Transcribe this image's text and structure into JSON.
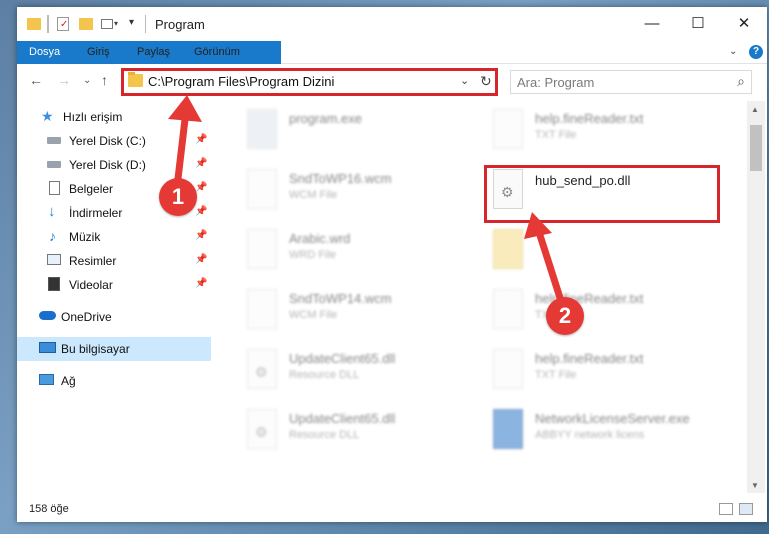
{
  "window": {
    "title": "Program",
    "minimize_icon": "minimize-icon",
    "maximize_icon": "maximize-icon",
    "close_icon": "close-icon",
    "help_icon": "help-icon"
  },
  "ribbon": {
    "tabs": [
      "Dosya",
      "Giriş",
      "Paylaş",
      "Görünüm"
    ]
  },
  "address": {
    "path": "C:\\Program Files\\Program Dizini",
    "search_placeholder": "Ara: Program"
  },
  "nav": {
    "items": [
      {
        "label": "Hızlı erişim",
        "icon": "star-icon",
        "pinned": false
      },
      {
        "label": "Yerel Disk (C:)",
        "icon": "drive-icon",
        "pinned": true
      },
      {
        "label": "Yerel Disk (D:)",
        "icon": "drive-icon",
        "pinned": true
      },
      {
        "label": "Belgeler",
        "icon": "documents-icon",
        "pinned": true
      },
      {
        "label": "İndirmeler",
        "icon": "download-icon",
        "pinned": true
      },
      {
        "label": "Müzik",
        "icon": "music-icon",
        "pinned": true
      },
      {
        "label": "Resimler",
        "icon": "pictures-icon",
        "pinned": true
      },
      {
        "label": "Videolar",
        "icon": "video-icon",
        "pinned": true
      },
      {
        "label": "OneDrive",
        "icon": "cloud-icon",
        "pinned": false
      },
      {
        "label": "Bu bilgisayar",
        "icon": "computer-icon",
        "pinned": false
      },
      {
        "label": "Ağ",
        "icon": "network-icon",
        "pinned": false
      }
    ]
  },
  "files": {
    "left": [
      {
        "name": "program.exe",
        "type": ""
      },
      {
        "name": "SndToWP16.wcm",
        "type": "WCM File"
      },
      {
        "name": "Arabic.wrd",
        "type": "WRD File"
      },
      {
        "name": "SndToWP14.wcm",
        "type": "WCM File"
      },
      {
        "name": "UpdateClient65.dll",
        "type": "Resource DLL"
      },
      {
        "name": "UpdateClient65.dll",
        "type": "Resource DLL"
      }
    ],
    "right": [
      {
        "name": "help.fineReader.txt",
        "type": "TXT File"
      },
      {
        "name": "hub_send_po.dll",
        "type": ""
      },
      {
        "name": "",
        "type": ""
      },
      {
        "name": "help.fineReader.txt",
        "type": "TXT File"
      },
      {
        "name": "help.fineReader.txt",
        "type": "TXT File"
      },
      {
        "name": "NetworkLicenseServer.exe",
        "type": "ABBYY network licens"
      }
    ]
  },
  "status": {
    "count": "158 öğe"
  },
  "annotations": {
    "step1": "1",
    "step2": "2",
    "color": "#d6252b"
  }
}
